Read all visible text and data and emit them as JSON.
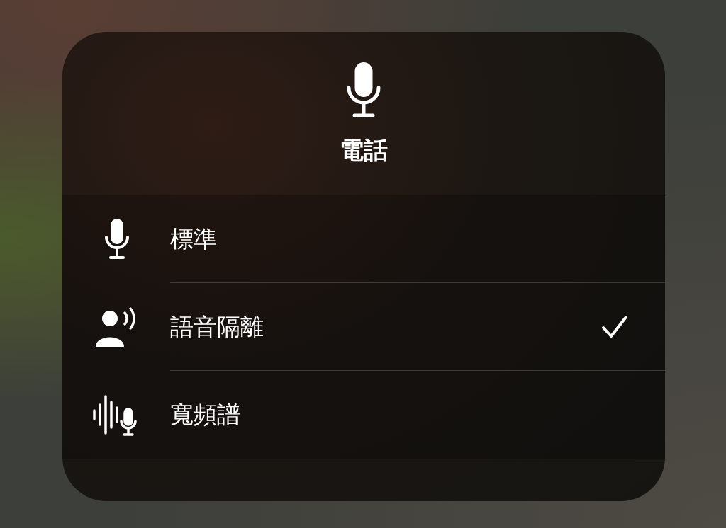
{
  "title": "電話",
  "options": [
    {
      "label": "標準",
      "kind": "standard",
      "selected": false
    },
    {
      "label": "語音隔離",
      "kind": "voice-isolation",
      "selected": true
    },
    {
      "label": "寬頻譜",
      "kind": "wide-spectrum",
      "selected": false
    }
  ]
}
